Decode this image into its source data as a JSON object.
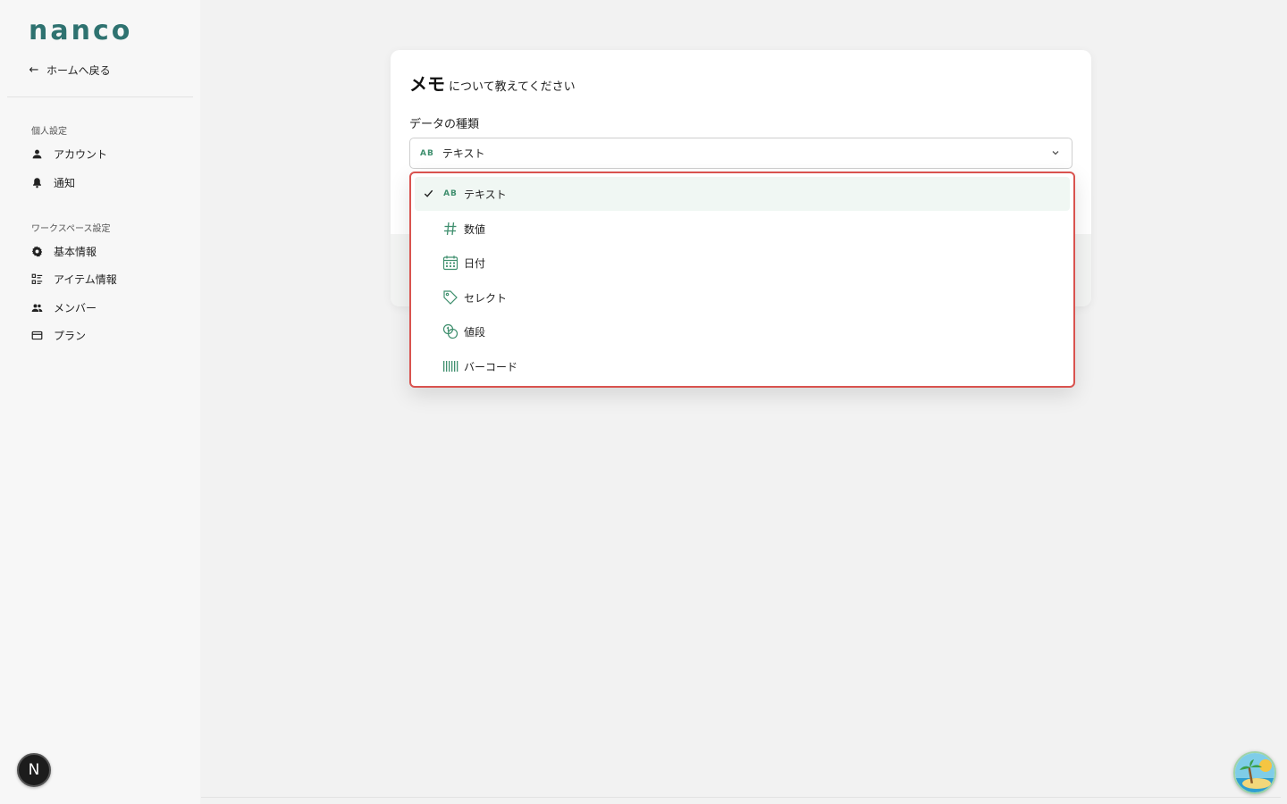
{
  "sidebar": {
    "logo": "nanco",
    "back_label": "ホームへ戻る",
    "personal_title": "個人設定",
    "personal_items": [
      {
        "label": "アカウント",
        "icon": "person-icon"
      },
      {
        "label": "通知",
        "icon": "bell-icon"
      }
    ],
    "workspace_title": "ワークスペース設定",
    "workspace_items": [
      {
        "label": "基本情報",
        "icon": "gear-icon"
      },
      {
        "label": "アイテム情報",
        "icon": "list-icon"
      },
      {
        "label": "メンバー",
        "icon": "group-icon"
      },
      {
        "label": "プラン",
        "icon": "card-icon"
      }
    ],
    "user_initial": "N"
  },
  "modal": {
    "title_bold": "メモ",
    "title_rest": "について教えてください",
    "field_label": "データの種類",
    "select_icon_text": "AB",
    "select_value": "テキスト"
  },
  "dropdown": {
    "options": [
      {
        "label": "テキスト",
        "icon": "ab-text-icon",
        "icon_text": "AB",
        "selected": true
      },
      {
        "label": "数値",
        "icon": "hash-icon",
        "selected": false
      },
      {
        "label": "日付",
        "icon": "calendar-icon",
        "selected": false
      },
      {
        "label": "セレクト",
        "icon": "tag-icon",
        "selected": false
      },
      {
        "label": "値段",
        "icon": "coins-icon",
        "selected": false
      },
      {
        "label": "バーコード",
        "icon": "barcode-icon",
        "selected": false
      }
    ]
  },
  "colors": {
    "accent": "#3f8f6e",
    "logo": "#2e7270",
    "dropdown_border": "#d9534f",
    "selected_bg": "#f0f7f3"
  }
}
